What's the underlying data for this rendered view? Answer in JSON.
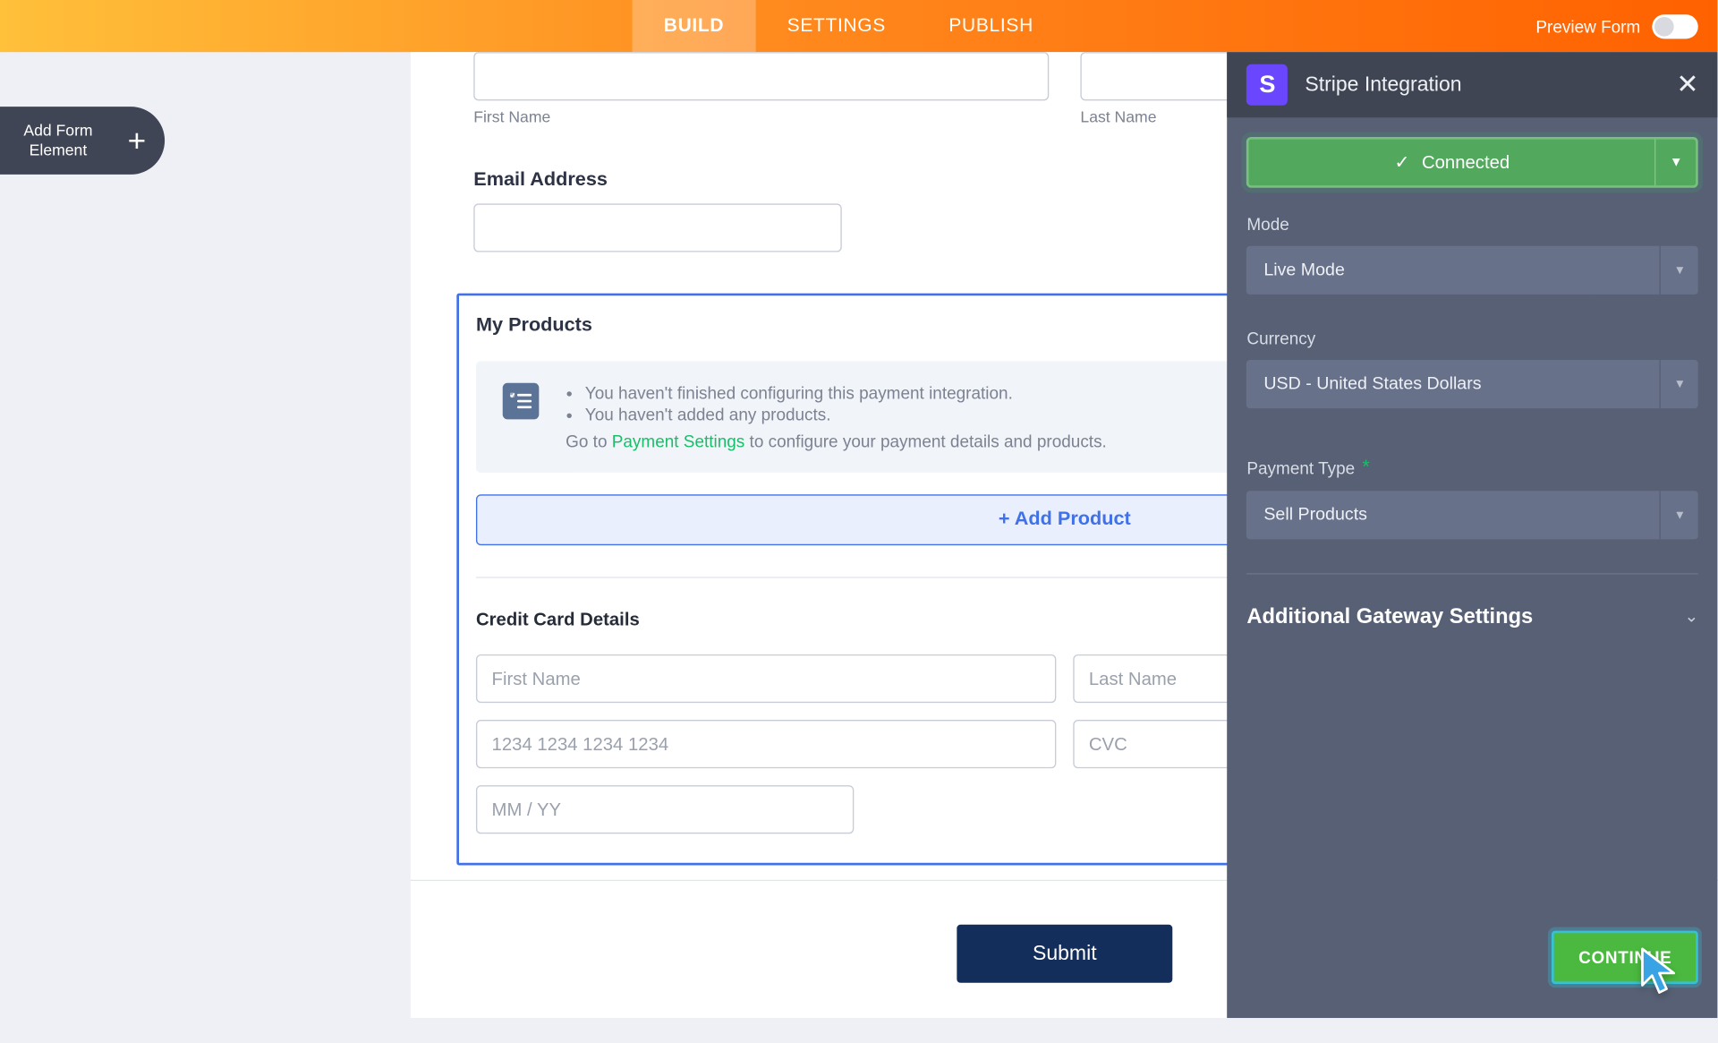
{
  "nav": {
    "tabs": [
      "BUILD",
      "SETTINGS",
      "PUBLISH"
    ],
    "preview_label": "Preview Form"
  },
  "sidebar": {
    "add_element_l1": "Add Form",
    "add_element_l2": "Element"
  },
  "form": {
    "first_name_sub": "First Name",
    "last_name_sub": "Last Name",
    "email_label": "Email Address",
    "products": {
      "title": "My Products",
      "info1": "You haven't finished configuring this payment integration.",
      "info2": "You haven't added any products.",
      "goto_pre": "Go to ",
      "goto_link": "Payment Settings",
      "goto_post": " to configure your payment details and products.",
      "add_btn": "+ Add Product"
    },
    "cc": {
      "title": "Credit Card Details",
      "first_name_ph": "First Name",
      "last_name_ph": "Last Name",
      "card_ph": "1234 1234 1234 1234",
      "cvc_ph": "CVC",
      "exp_ph": "MM / YY"
    },
    "submit": "Submit"
  },
  "panel": {
    "title": "Stripe Integration",
    "connected": "Connected",
    "mode_label": "Mode",
    "mode_value": "Live Mode",
    "currency_label": "Currency",
    "currency_value": "USD - United States Dollars",
    "ptype_label": "Payment Type",
    "ptype_value": "Sell Products",
    "accordion": "Additional Gateway Settings",
    "continue": "CONTINUE"
  }
}
